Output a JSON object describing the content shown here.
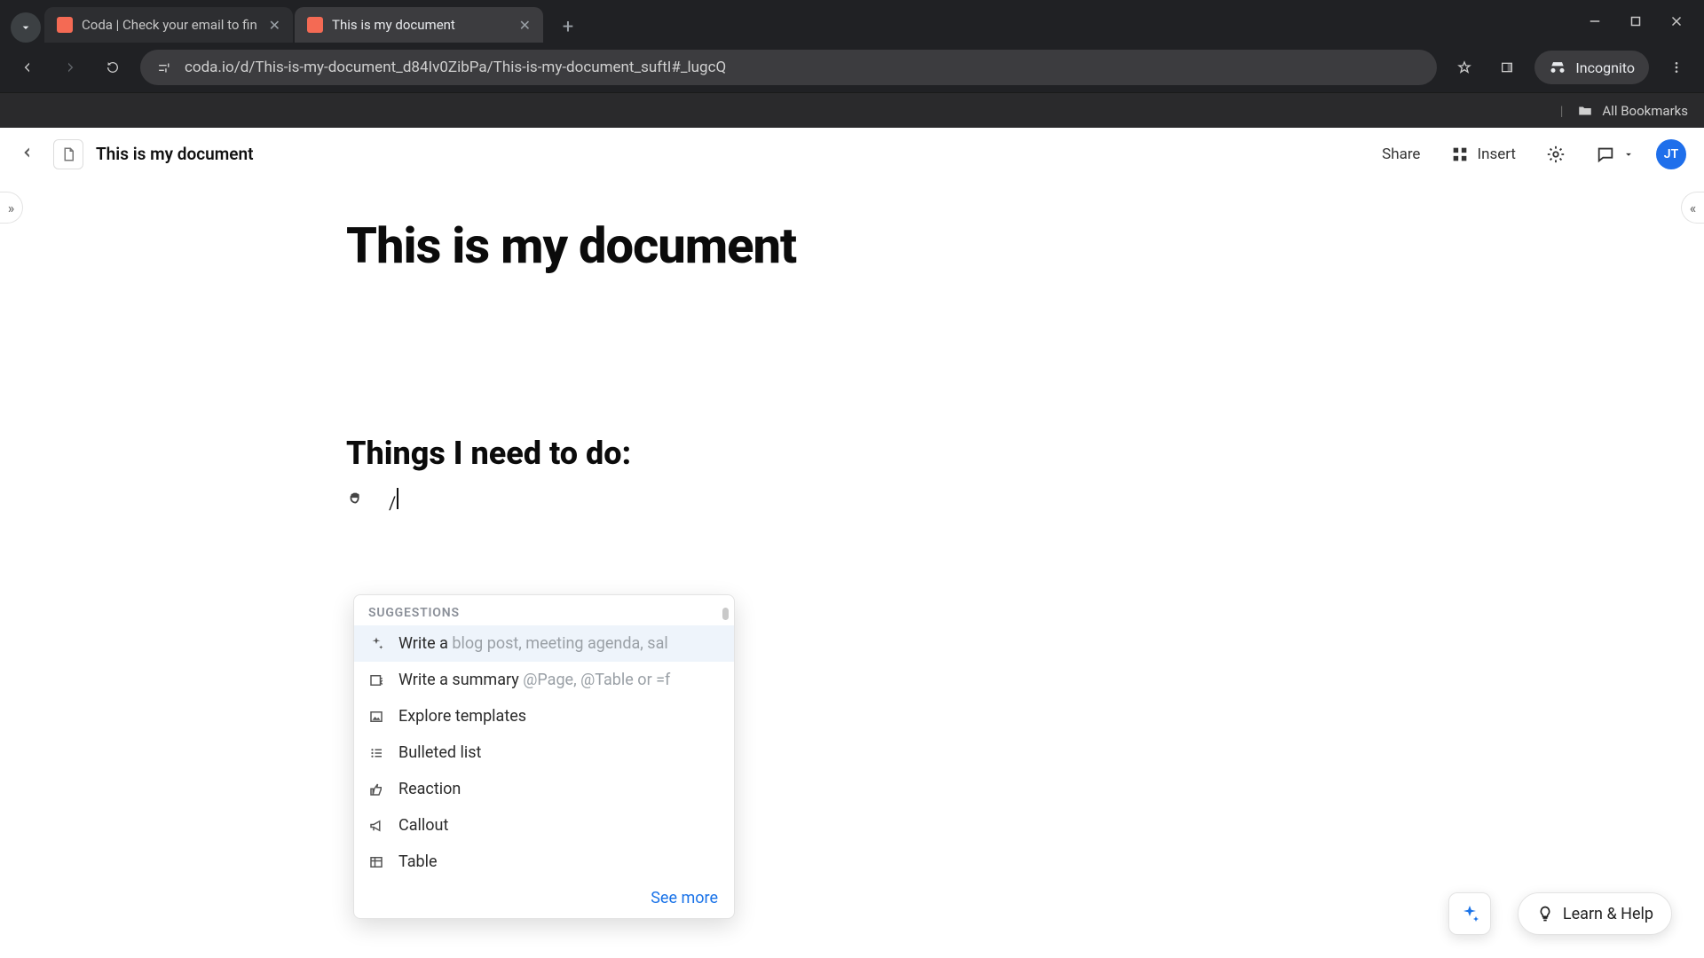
{
  "browser": {
    "tabs": [
      {
        "title": "Coda | Check your email to fin",
        "active": false
      },
      {
        "title": "This is my document",
        "active": true
      }
    ],
    "url": "coda.io/d/This-is-my-document_d84Iv0ZibPa/This-is-my-document_suftI#_lugcQ",
    "incognito_label": "Incognito",
    "bookmarks_label": "All Bookmarks"
  },
  "header": {
    "doc_title": "This is my document",
    "share_label": "Share",
    "insert_label": "Insert",
    "avatar_initials": "JT"
  },
  "document": {
    "title": "This is my document",
    "heading": "Things I need to do:",
    "slash_input": "/"
  },
  "suggestions": {
    "header": "SUGGESTIONS",
    "items": [
      {
        "icon": "ai-sparkle-icon",
        "text": "Write a ",
        "hint": "blog post, meeting agenda, sal"
      },
      {
        "icon": "summary-icon",
        "text": "Write a summary ",
        "hint": "@Page, @Table or =f"
      },
      {
        "icon": "image-icon",
        "text": "Explore templates",
        "hint": ""
      },
      {
        "icon": "list-icon",
        "text": "Bulleted list",
        "hint": ""
      },
      {
        "icon": "thumbs-up-icon",
        "text": "Reaction",
        "hint": ""
      },
      {
        "icon": "megaphone-icon",
        "text": "Callout",
        "hint": ""
      },
      {
        "icon": "table-icon",
        "text": "Table",
        "hint": ""
      }
    ],
    "see_more": "See more"
  },
  "footer": {
    "learn_help": "Learn & Help"
  }
}
